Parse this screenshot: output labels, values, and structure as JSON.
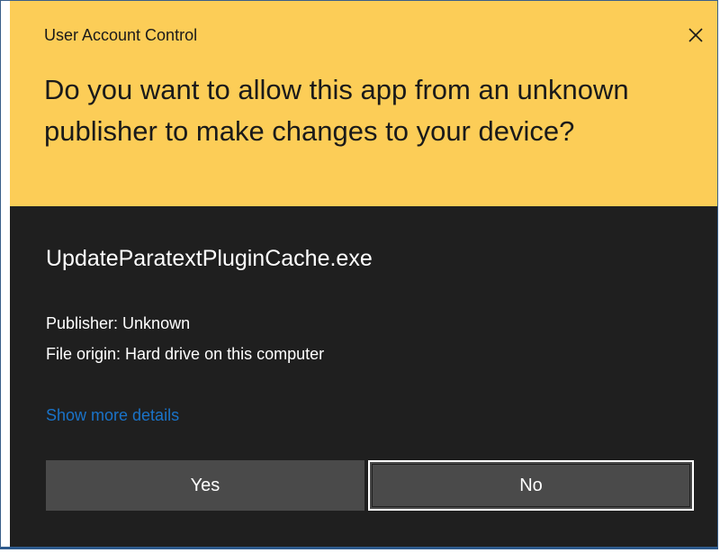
{
  "window": {
    "title": "User Account Control",
    "close_icon": "close-icon"
  },
  "prompt": {
    "question": "Do you want to allow this app from an unknown publisher to make changes to your device?"
  },
  "app": {
    "name": "UpdateParatextPluginCache.exe",
    "publisher": "Publisher: Unknown",
    "file_origin": "File origin: Hard drive on this computer"
  },
  "links": {
    "details": "Show more details"
  },
  "buttons": {
    "yes": "Yes",
    "no": "No"
  },
  "colors": {
    "header_bg": "#fccd57",
    "body_bg": "#1f1f1f",
    "link": "#1a73c8",
    "button_bg": "#4a4a4a"
  }
}
